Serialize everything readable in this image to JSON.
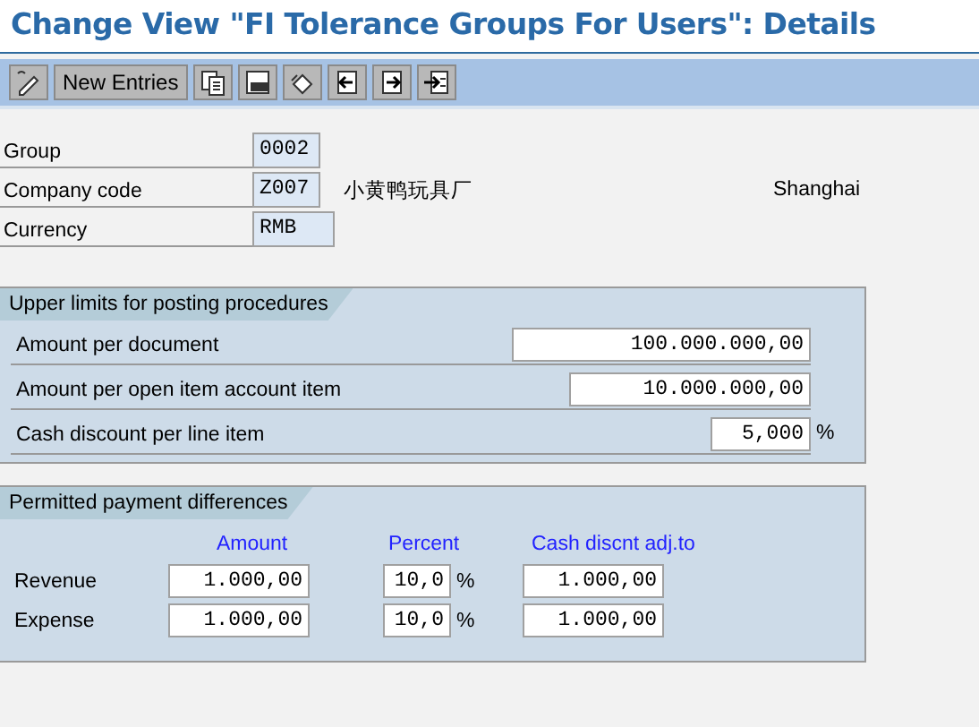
{
  "window": {
    "title": "Change View \"FI Tolerance Groups For Users\": Details"
  },
  "toolbar": {
    "new_entries": "New Entries"
  },
  "header_fields": [
    {
      "label": "Group",
      "value": "0002"
    },
    {
      "label": "Company code",
      "value": "Z007",
      "description": "小黄鸭玩具厂",
      "city": "Shanghai"
    },
    {
      "label": "Currency",
      "value": "RMB"
    }
  ],
  "upper_limits": {
    "title": "Upper limits for posting procedures",
    "rows": [
      {
        "label": "Amount per document",
        "value": "100.000.000,00"
      },
      {
        "label": "Amount per open item account item",
        "value": "10.000.000,00"
      },
      {
        "label": "Cash discount per line item",
        "value": "5,000",
        "unit": "%"
      }
    ]
  },
  "payment_differences": {
    "title": "Permitted payment differences",
    "columns": [
      "Amount",
      "Percent",
      "Cash discnt adj.to"
    ],
    "rows": [
      {
        "label": "Revenue",
        "amount": "1.000,00",
        "percent": "10,0",
        "unit": "%",
        "cash_discount": "1.000,00"
      },
      {
        "label": "Expense",
        "amount": "1.000,00",
        "percent": "10,0",
        "unit": "%",
        "cash_discount": "1.000,00"
      }
    ]
  }
}
